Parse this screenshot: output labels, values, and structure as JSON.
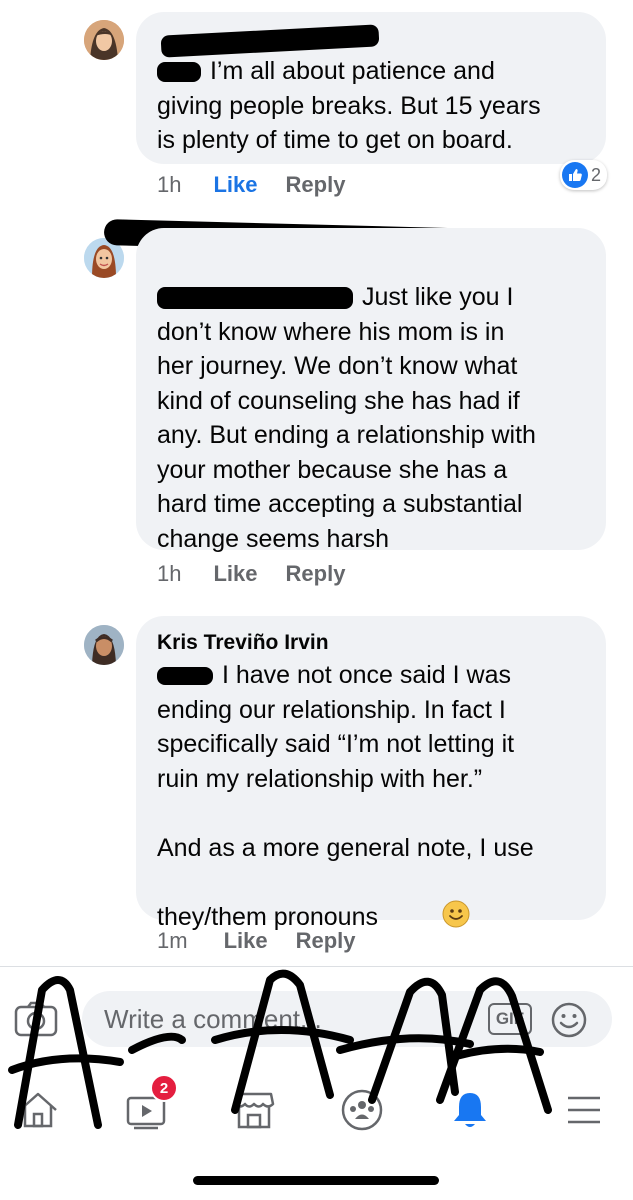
{
  "comments": [
    {
      "author": "",
      "text": " I’m all about patience and\ngiving people breaks. But 15 years\nis plenty of time to get on board.",
      "time": "1h",
      "like_label": "Like",
      "reply_label": "Reply",
      "reaction_count": "2",
      "like_active": true
    },
    {
      "author": "",
      "text": " Just like you I\ndon’t know where his mom is in\nher journey. We don’t know what\nkind of counseling she has had if\nany. But ending a relationship with\nyour mother because she has a\nhard time accepting a substantial\nchange seems harsh",
      "time": "1h",
      "like_label": "Like",
      "reply_label": "Reply",
      "like_active": false
    },
    {
      "author": "Kris Treviño Irvin",
      "text": " I have not once said I was\nending our relationship. In fact I\nspecifically said “I’m not letting it\nruin my relationship with her.”\n\nAnd as a more general note, I use\nthey/them pronouns",
      "time": "1m",
      "like_label": "Like",
      "reply_label": "Reply",
      "like_active": false
    }
  ],
  "composer": {
    "placeholder": "Write a comment...",
    "gif_label": "GIF"
  },
  "tabbar": {
    "items": [
      {
        "icon": "home-icon"
      },
      {
        "icon": "watch-icon",
        "badge": "2"
      },
      {
        "icon": "marketplace-icon"
      },
      {
        "icon": "groups-icon"
      },
      {
        "icon": "notifications-icon"
      },
      {
        "icon": "menu-icon"
      }
    ]
  },
  "colors": {
    "bubble": "#f0f2f5",
    "like_blue": "#1b74e4",
    "meta_gray": "#65676b",
    "badge_red": "#e41e3f"
  }
}
